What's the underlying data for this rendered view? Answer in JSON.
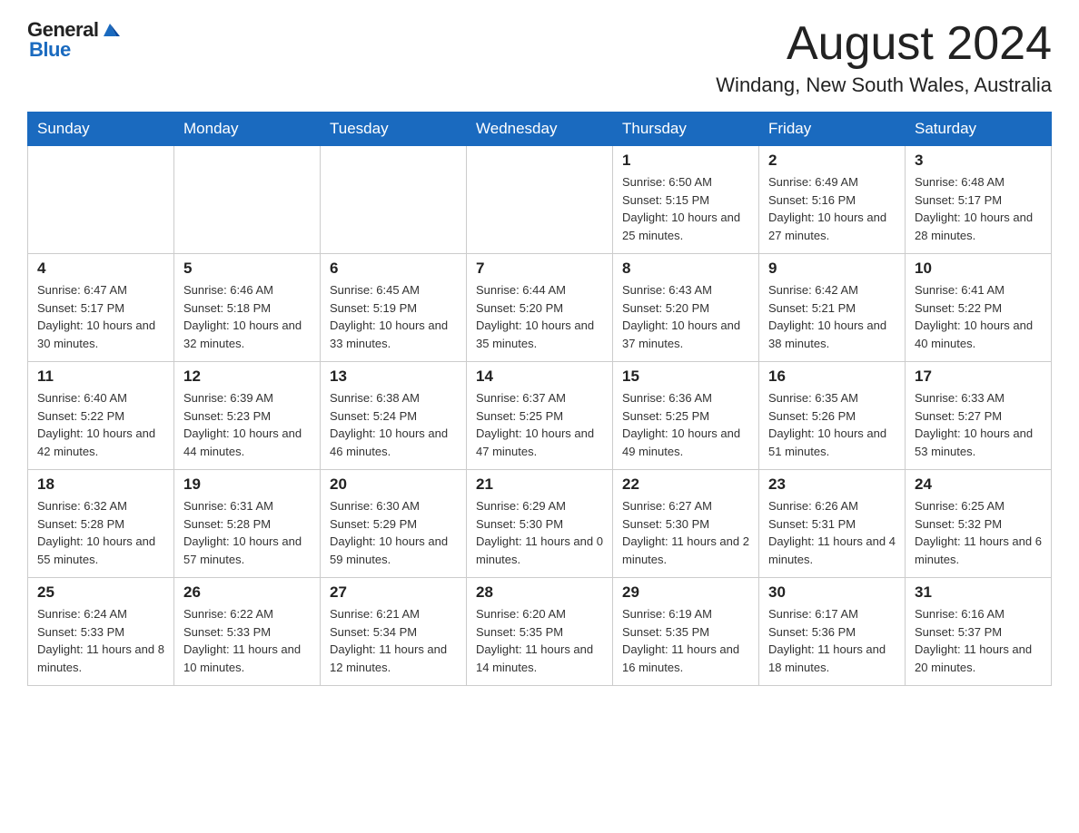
{
  "logo": {
    "text_general": "General",
    "text_blue": "Blue"
  },
  "header": {
    "month_year": "August 2024",
    "location": "Windang, New South Wales, Australia"
  },
  "weekdays": [
    "Sunday",
    "Monday",
    "Tuesday",
    "Wednesday",
    "Thursday",
    "Friday",
    "Saturday"
  ],
  "weeks": [
    [
      {
        "day": "",
        "info": ""
      },
      {
        "day": "",
        "info": ""
      },
      {
        "day": "",
        "info": ""
      },
      {
        "day": "",
        "info": ""
      },
      {
        "day": "1",
        "info": "Sunrise: 6:50 AM\nSunset: 5:15 PM\nDaylight: 10 hours and 25 minutes."
      },
      {
        "day": "2",
        "info": "Sunrise: 6:49 AM\nSunset: 5:16 PM\nDaylight: 10 hours and 27 minutes."
      },
      {
        "day": "3",
        "info": "Sunrise: 6:48 AM\nSunset: 5:17 PM\nDaylight: 10 hours and 28 minutes."
      }
    ],
    [
      {
        "day": "4",
        "info": "Sunrise: 6:47 AM\nSunset: 5:17 PM\nDaylight: 10 hours and 30 minutes."
      },
      {
        "day": "5",
        "info": "Sunrise: 6:46 AM\nSunset: 5:18 PM\nDaylight: 10 hours and 32 minutes."
      },
      {
        "day": "6",
        "info": "Sunrise: 6:45 AM\nSunset: 5:19 PM\nDaylight: 10 hours and 33 minutes."
      },
      {
        "day": "7",
        "info": "Sunrise: 6:44 AM\nSunset: 5:20 PM\nDaylight: 10 hours and 35 minutes."
      },
      {
        "day": "8",
        "info": "Sunrise: 6:43 AM\nSunset: 5:20 PM\nDaylight: 10 hours and 37 minutes."
      },
      {
        "day": "9",
        "info": "Sunrise: 6:42 AM\nSunset: 5:21 PM\nDaylight: 10 hours and 38 minutes."
      },
      {
        "day": "10",
        "info": "Sunrise: 6:41 AM\nSunset: 5:22 PM\nDaylight: 10 hours and 40 minutes."
      }
    ],
    [
      {
        "day": "11",
        "info": "Sunrise: 6:40 AM\nSunset: 5:22 PM\nDaylight: 10 hours and 42 minutes."
      },
      {
        "day": "12",
        "info": "Sunrise: 6:39 AM\nSunset: 5:23 PM\nDaylight: 10 hours and 44 minutes."
      },
      {
        "day": "13",
        "info": "Sunrise: 6:38 AM\nSunset: 5:24 PM\nDaylight: 10 hours and 46 minutes."
      },
      {
        "day": "14",
        "info": "Sunrise: 6:37 AM\nSunset: 5:25 PM\nDaylight: 10 hours and 47 minutes."
      },
      {
        "day": "15",
        "info": "Sunrise: 6:36 AM\nSunset: 5:25 PM\nDaylight: 10 hours and 49 minutes."
      },
      {
        "day": "16",
        "info": "Sunrise: 6:35 AM\nSunset: 5:26 PM\nDaylight: 10 hours and 51 minutes."
      },
      {
        "day": "17",
        "info": "Sunrise: 6:33 AM\nSunset: 5:27 PM\nDaylight: 10 hours and 53 minutes."
      }
    ],
    [
      {
        "day": "18",
        "info": "Sunrise: 6:32 AM\nSunset: 5:28 PM\nDaylight: 10 hours and 55 minutes."
      },
      {
        "day": "19",
        "info": "Sunrise: 6:31 AM\nSunset: 5:28 PM\nDaylight: 10 hours and 57 minutes."
      },
      {
        "day": "20",
        "info": "Sunrise: 6:30 AM\nSunset: 5:29 PM\nDaylight: 10 hours and 59 minutes."
      },
      {
        "day": "21",
        "info": "Sunrise: 6:29 AM\nSunset: 5:30 PM\nDaylight: 11 hours and 0 minutes."
      },
      {
        "day": "22",
        "info": "Sunrise: 6:27 AM\nSunset: 5:30 PM\nDaylight: 11 hours and 2 minutes."
      },
      {
        "day": "23",
        "info": "Sunrise: 6:26 AM\nSunset: 5:31 PM\nDaylight: 11 hours and 4 minutes."
      },
      {
        "day": "24",
        "info": "Sunrise: 6:25 AM\nSunset: 5:32 PM\nDaylight: 11 hours and 6 minutes."
      }
    ],
    [
      {
        "day": "25",
        "info": "Sunrise: 6:24 AM\nSunset: 5:33 PM\nDaylight: 11 hours and 8 minutes."
      },
      {
        "day": "26",
        "info": "Sunrise: 6:22 AM\nSunset: 5:33 PM\nDaylight: 11 hours and 10 minutes."
      },
      {
        "day": "27",
        "info": "Sunrise: 6:21 AM\nSunset: 5:34 PM\nDaylight: 11 hours and 12 minutes."
      },
      {
        "day": "28",
        "info": "Sunrise: 6:20 AM\nSunset: 5:35 PM\nDaylight: 11 hours and 14 minutes."
      },
      {
        "day": "29",
        "info": "Sunrise: 6:19 AM\nSunset: 5:35 PM\nDaylight: 11 hours and 16 minutes."
      },
      {
        "day": "30",
        "info": "Sunrise: 6:17 AM\nSunset: 5:36 PM\nDaylight: 11 hours and 18 minutes."
      },
      {
        "day": "31",
        "info": "Sunrise: 6:16 AM\nSunset: 5:37 PM\nDaylight: 11 hours and 20 minutes."
      }
    ]
  ]
}
